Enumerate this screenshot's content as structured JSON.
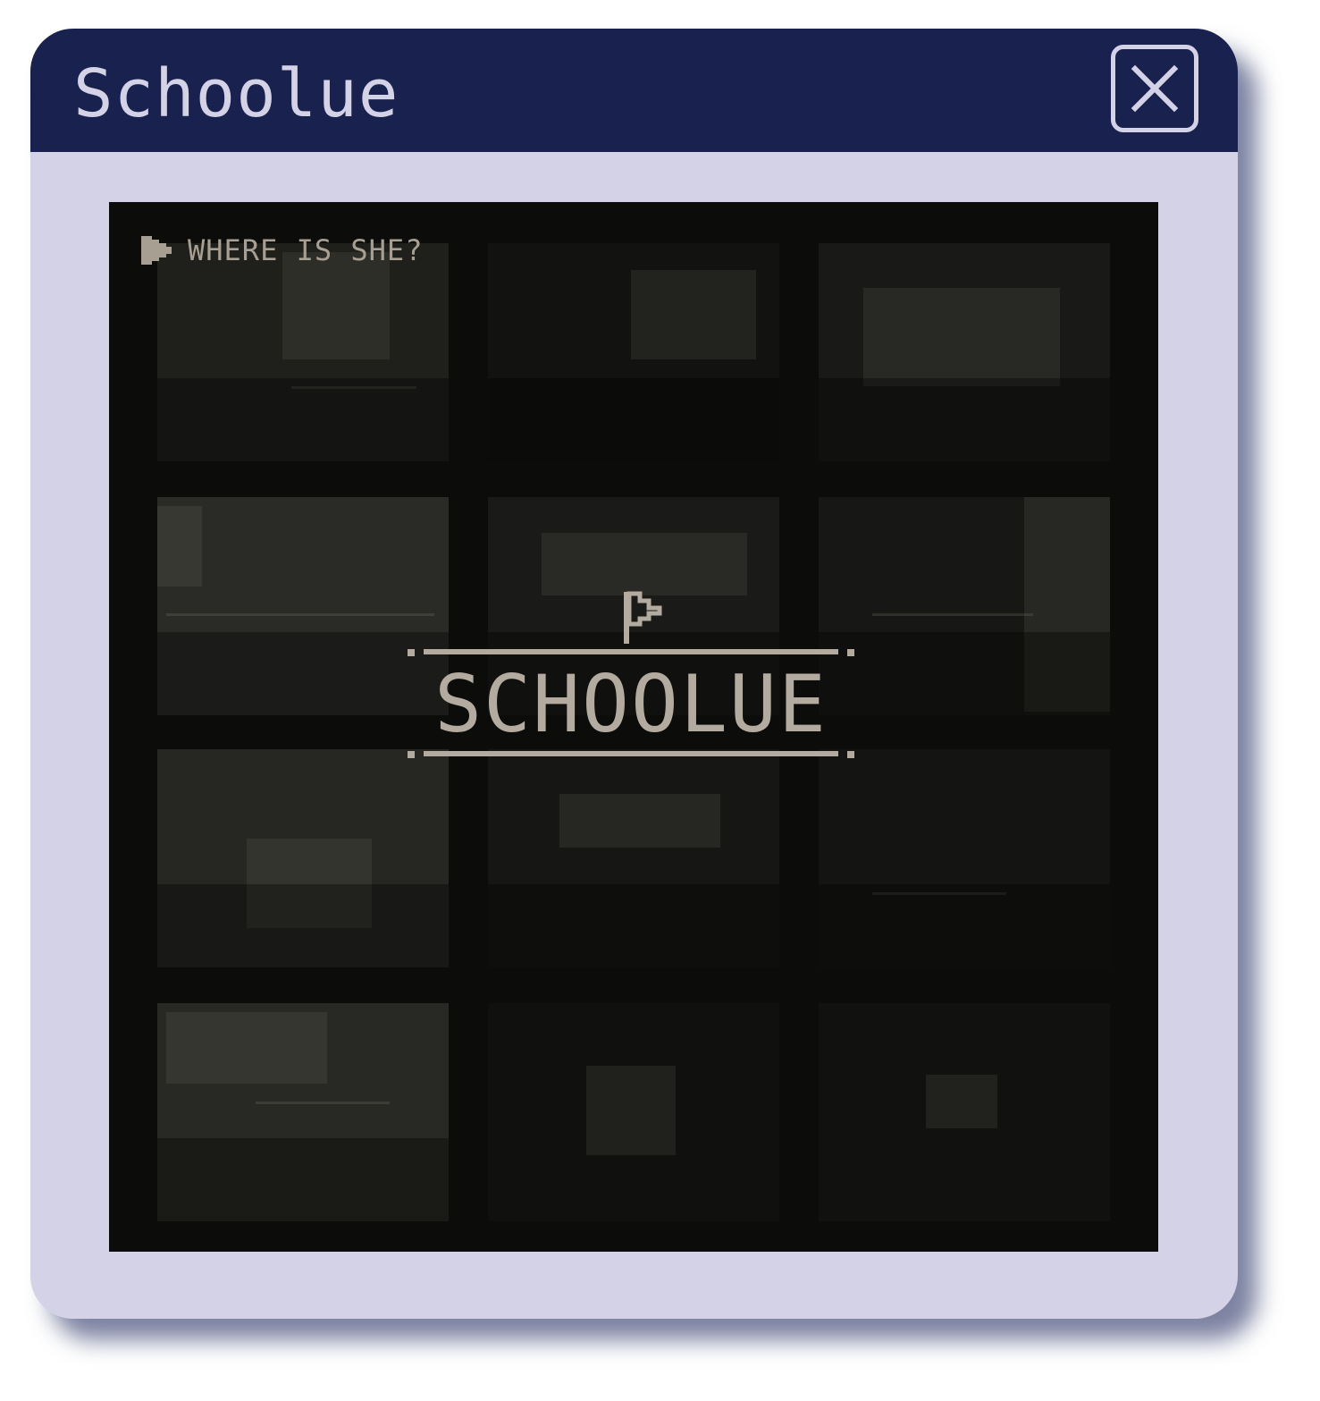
{
  "window": {
    "title": "Schoolue"
  },
  "game": {
    "prompt": "WHERE IS SHE?",
    "logo_text": "SCHOOLUE"
  },
  "colors": {
    "titlebar": "#19224f",
    "window_body": "#d4d2e7",
    "screen_bg": "#0c0c0a",
    "logo": "#b3aaa0"
  },
  "icons": {
    "close": "close-icon",
    "prompt_arrow": "play-arrow-icon",
    "logo_flag": "flag-icon"
  }
}
